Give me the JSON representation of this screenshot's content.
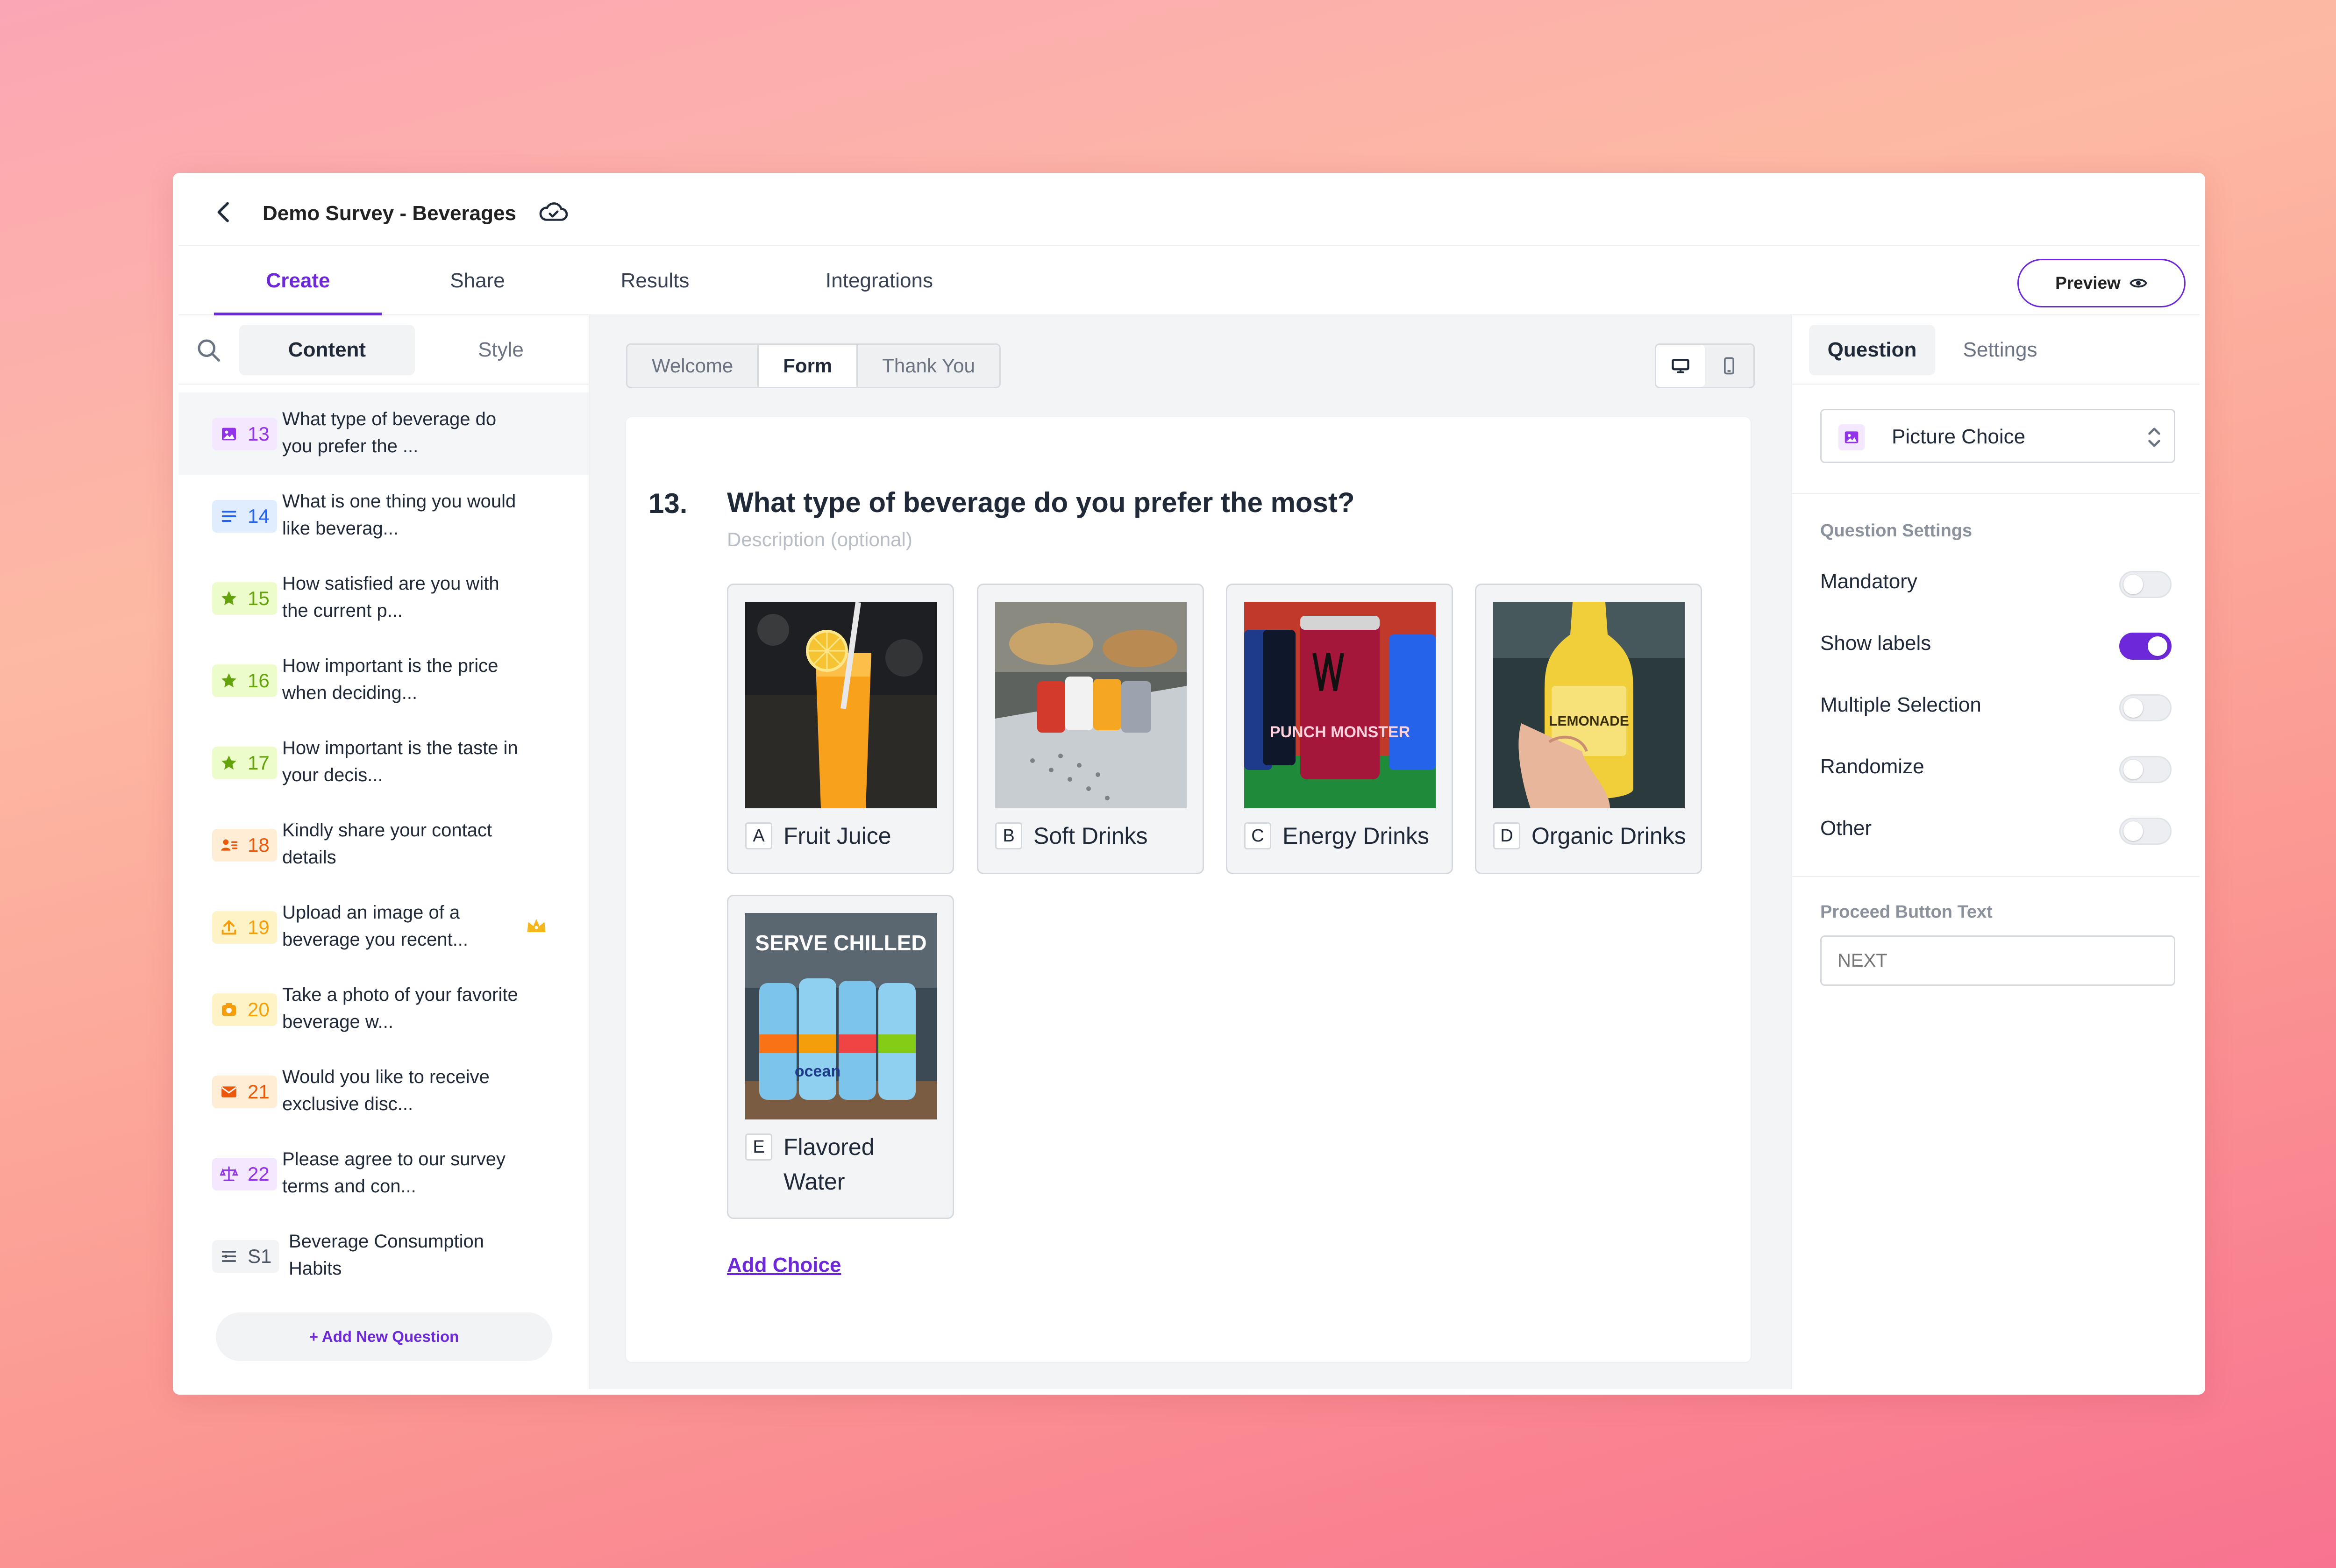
{
  "header": {
    "title": "Demo Survey - Beverages"
  },
  "tabs": [
    "Create",
    "Share",
    "Results",
    "Integrations"
  ],
  "active_tab": "Create",
  "preview_label": "Preview",
  "sidebar": {
    "segments": [
      "Content",
      "Style"
    ],
    "questions": [
      {
        "num": "13",
        "text": "What type of beverage do you prefer the ...",
        "icon": "image-icon",
        "color": "#9333ea",
        "bg": "#f3e8ff"
      },
      {
        "num": "14",
        "text": "What is one thing you would like beverag...",
        "icon": "text-lines-icon",
        "color": "#2563eb",
        "bg": "#e0ecff"
      },
      {
        "num": "15",
        "text": "How satisfied are you with the current p...",
        "icon": "star-icon",
        "color": "#65a30d",
        "bg": "#ecfccb"
      },
      {
        "num": "16",
        "text": "How important is the price when deciding...",
        "icon": "star-icon",
        "color": "#65a30d",
        "bg": "#ecfccb"
      },
      {
        "num": "17",
        "text": "How important is the taste in your decis...",
        "icon": "star-icon",
        "color": "#65a30d",
        "bg": "#ecfccb"
      },
      {
        "num": "18",
        "text": "Kindly share your contact details",
        "icon": "contact-icon",
        "color": "#ea580c",
        "bg": "#ffedd5"
      },
      {
        "num": "19",
        "text": "Upload an image of a beverage you recent...",
        "icon": "upload-icon",
        "color": "#f59e0b",
        "bg": "#fef3c7"
      },
      {
        "num": "20",
        "text": "Take a photo of your favorite beverage w...",
        "icon": "camera-icon",
        "color": "#f59e0b",
        "bg": "#fef3c7"
      },
      {
        "num": "21",
        "text": "Would you like to receive exclusive disc...",
        "icon": "mail-icon",
        "color": "#ea580c",
        "bg": "#ffedd5"
      },
      {
        "num": "22",
        "text": "Please agree to our survey terms and con...",
        "icon": "scale-icon",
        "color": "#9333ea",
        "bg": "#f3e8ff"
      },
      {
        "num": "S1",
        "text": "Beverage Consumption Habits",
        "icon": "section-icon",
        "color": "#4b5563",
        "bg": "#f3f4f6"
      }
    ],
    "add_question_label": "+ Add New Question"
  },
  "form_tabs": [
    "Welcome",
    "Form",
    "Thank You"
  ],
  "question": {
    "number": "13.",
    "title": "What type of beverage do you prefer the most?",
    "description_placeholder": "Description (optional)",
    "choices": [
      {
        "letter": "A",
        "label": "Fruit Juice"
      },
      {
        "letter": "B",
        "label": "Soft Drinks"
      },
      {
        "letter": "C",
        "label": "Energy Drinks"
      },
      {
        "letter": "D",
        "label": "Organic Drinks"
      },
      {
        "letter": "E",
        "label": "Flavored Water"
      }
    ],
    "add_choice_label": "Add Choice"
  },
  "images": {
    "juice_brand": "",
    "energy_text": "PUNCH MONSTER",
    "lemonade_text": "LEMONADE",
    "water_banner": "SERVE CHILLED",
    "water_brand": "ocean"
  },
  "right_panel": {
    "tabs": [
      "Question",
      "Settings"
    ],
    "question_type": "Picture Choice",
    "settings_header": "Question Settings",
    "settings": [
      {
        "label": "Mandatory",
        "on": false
      },
      {
        "label": "Show labels",
        "on": true
      },
      {
        "label": "Multiple Selection",
        "on": false
      },
      {
        "label": "Randomize",
        "on": false
      },
      {
        "label": "Other",
        "on": false
      }
    ],
    "proceed_header": "Proceed Button Text",
    "proceed_placeholder": "NEXT"
  },
  "colors": {
    "accent": "#6d28d9"
  }
}
